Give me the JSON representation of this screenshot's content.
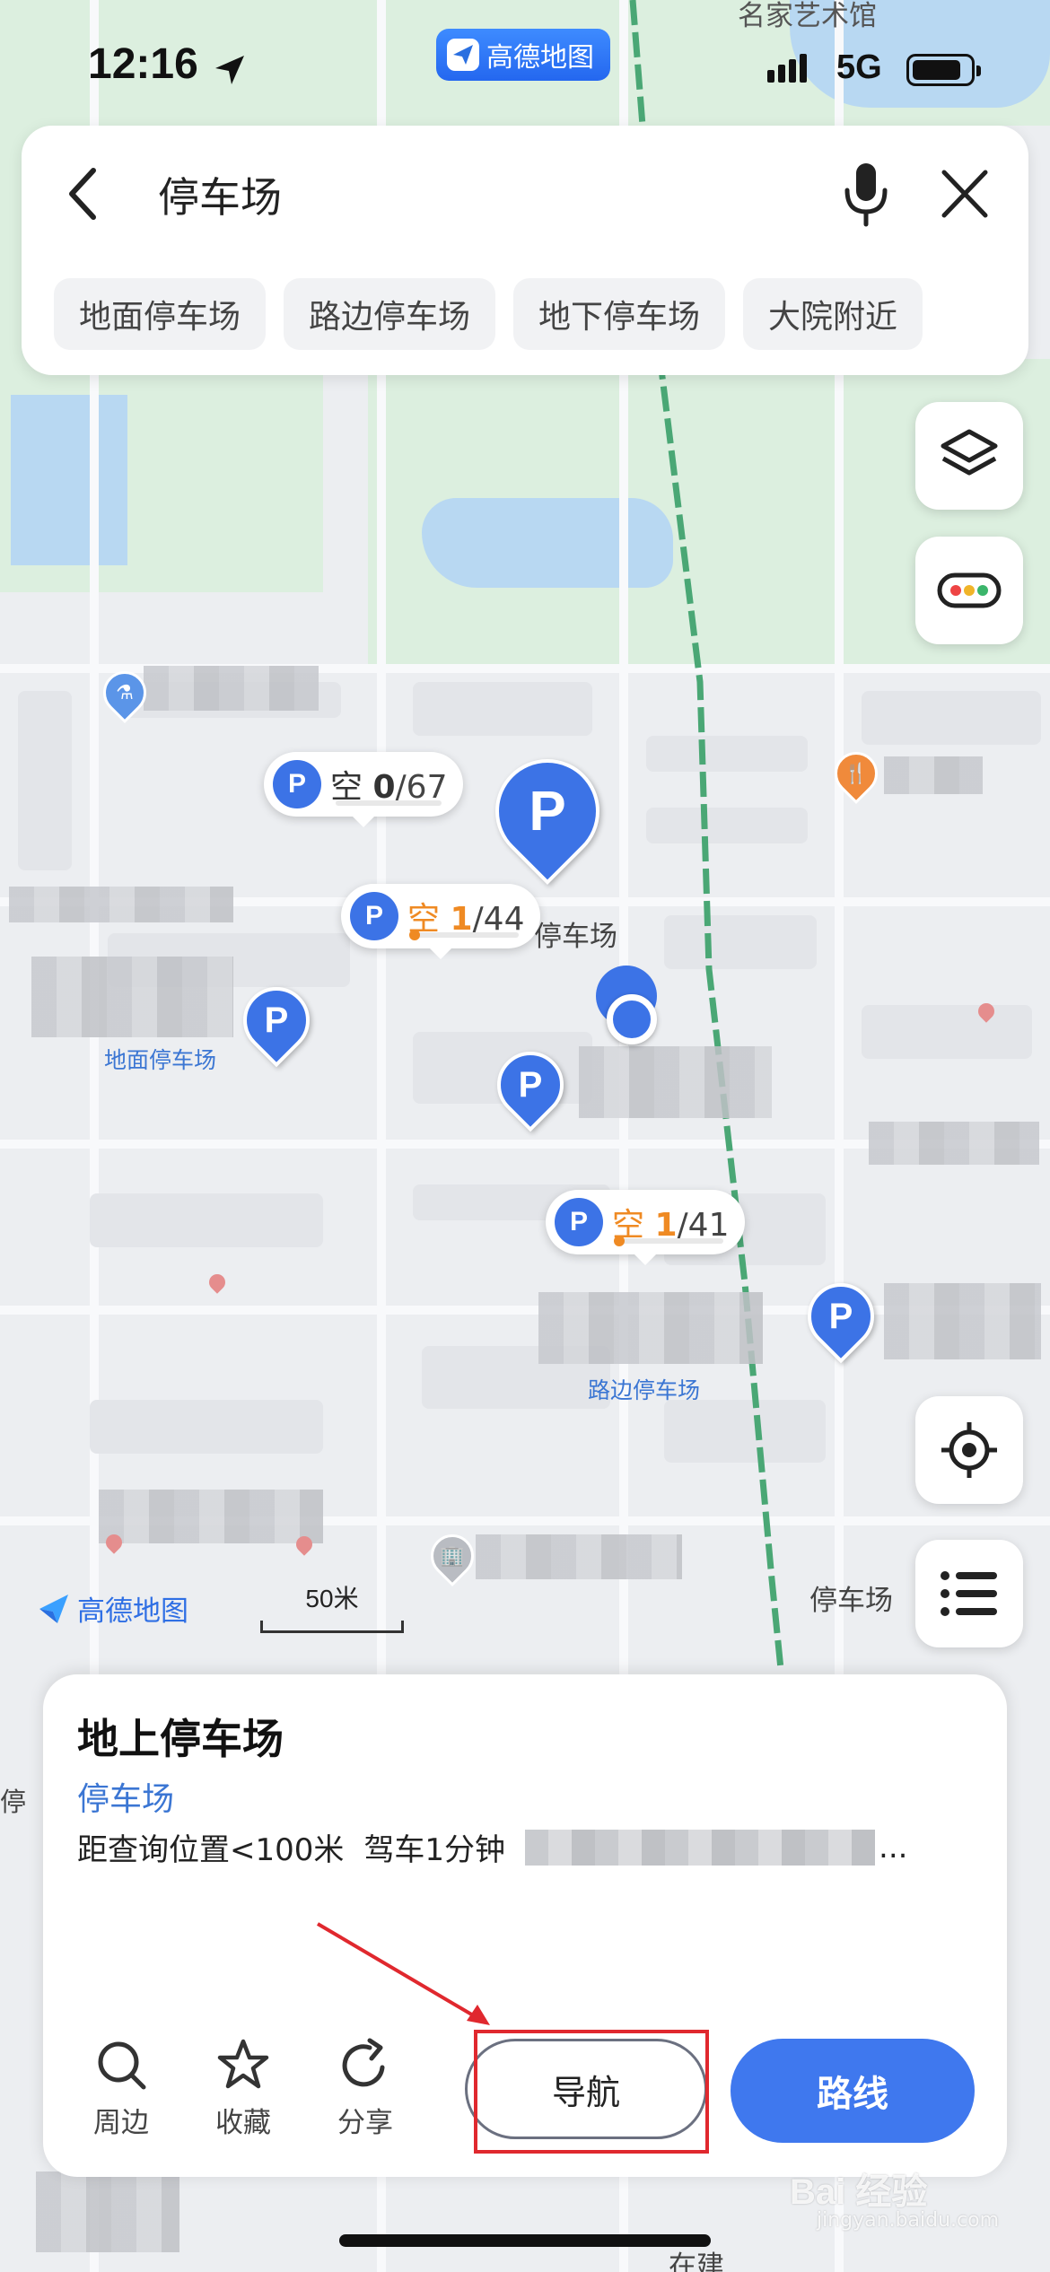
{
  "status_bar": {
    "time": "12:16",
    "network": "5G",
    "app_badge": "高德地图"
  },
  "search": {
    "query": "停车场"
  },
  "filter_chips": [
    "地面停车场",
    "路边停车场",
    "地下停车场",
    "大院附近"
  ],
  "map": {
    "top_label": "名家艺术馆",
    "labels": {
      "ground_parking": "地面停车场",
      "roadside_parking": "路边停车场",
      "parking_center": "停车场",
      "parking_right": "停车场",
      "parking_left": "停",
      "road_bottom": "在建"
    },
    "bubbles": [
      {
        "prefix": "空",
        "available": "0",
        "total": "/67",
        "highlight": false
      },
      {
        "prefix": "空",
        "available": "1",
        "total": "/44",
        "highlight": true
      },
      {
        "prefix": "空",
        "available": "1",
        "total": "/41",
        "highlight": true
      }
    ],
    "pin_letter": "P",
    "brand": "高德地图",
    "scale": "50米"
  },
  "sheet": {
    "name": "地上停车场",
    "category": "停车场",
    "distance": "距查询位置<100米",
    "drive": "驾车1分钟",
    "ellipsis": "...",
    "actions": {
      "nearby": "周边",
      "favorite": "收藏",
      "share": "分享"
    },
    "nav_label": "导航",
    "route_label": "路线"
  },
  "watermark": {
    "main": "Bai 经验",
    "sub": "jingyan.baidu.com"
  },
  "colors": {
    "accent": "#3f78ee",
    "available_orange": "#ef8a23",
    "annotation_red": "#e0282e"
  }
}
